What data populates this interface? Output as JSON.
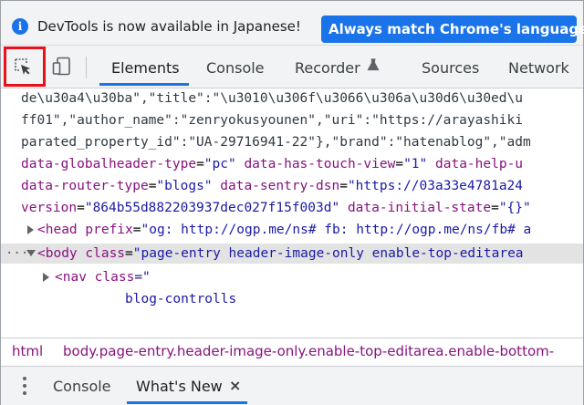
{
  "infobar": {
    "icon": "info-icon",
    "message": "DevTools is now available in Japanese!",
    "match_button": "Always match Chrome's language"
  },
  "toolbar": {
    "inspect_icon": "inspect-element-icon",
    "device_icon": "device-toolbar-icon",
    "tabs": [
      {
        "label": "Elements",
        "active": true
      },
      {
        "label": "Console",
        "active": false
      },
      {
        "label": "Recorder",
        "active": false
      },
      {
        "label": "Sources",
        "active": false
      },
      {
        "label": "Network",
        "active": false
      }
    ],
    "highlight_color": "#e8101a",
    "accent_color": "#1a73e8"
  },
  "elements": {
    "lines": [
      "de\\u30a4\\u30ba\",\"title\":\"\\u3010\\u306f\\u3066\\u306a\\u30d6\\u30ed\\u",
      "ff01\",\"author_name\":\"zenryokusyounen\",\"uri\":\"https://arayashiki",
      "parated_property_id\":\"UA-29716941-22\"},\"brand\":\"hatenablog\",\"adm"
    ],
    "attr_lines": [
      {
        "name": "data-globalheader-type",
        "value": "\"pc\"",
        "name2": "data-has-touch-view",
        "value2": "\"1\"",
        "name3": "data-help-u",
        "value3": ""
      },
      {
        "name": "data-router-type",
        "value": "\"blogs\"",
        "name2": "data-sentry-dsn",
        "value2": "\"https://03a33e4781a24",
        "name3": "",
        "value3": ""
      },
      {
        "name": "version",
        "value": "\"864b55d882203937dec027f15f003d\"",
        "name2": "data-initial-state",
        "value2": "\"{}\"",
        "name3": "",
        "value3": ""
      }
    ],
    "head_line": {
      "tag": "<head",
      "attr": "prefix",
      "value": "\"og: http://ogp.me/ns# fb: http://ogp.me/ns/fb# a"
    },
    "body_line": {
      "dots": "···",
      "tag": "<body",
      "attr": "class",
      "value": "\"page-entry header-image-only enable-top-editarea"
    },
    "nav_line": {
      "tag": "<nav",
      "attr": "class",
      "value_open": "=\""
    },
    "nav_value": "blog-controlls"
  },
  "breadcrumbs": [
    "html",
    "body.page-entry.header-image-only.enable-top-editarea.enable-bottom-"
  ],
  "drawer": {
    "menu_icon": "kebab-menu-icon",
    "tabs": [
      {
        "label": "Console",
        "active": false
      },
      {
        "label": "What's New",
        "active": true
      }
    ],
    "close_label": "×"
  }
}
